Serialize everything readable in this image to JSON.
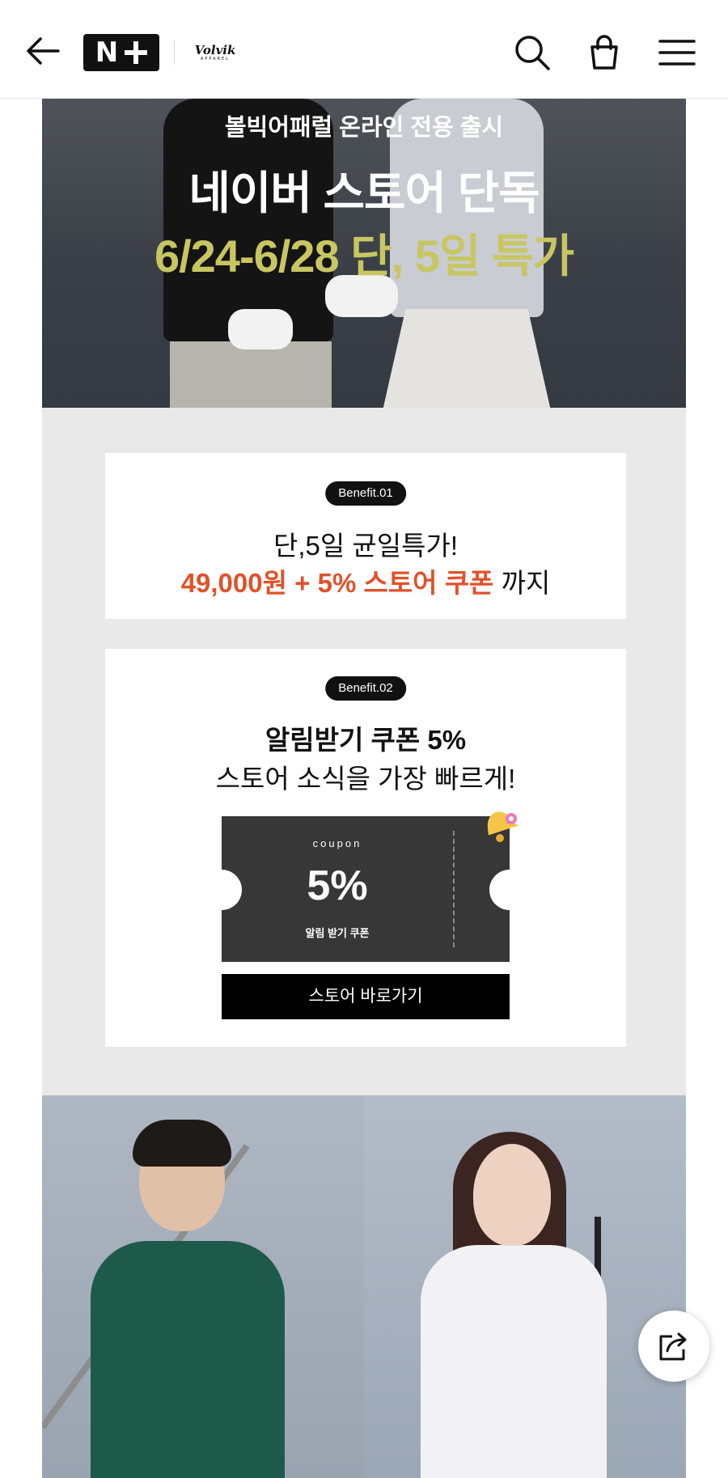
{
  "header": {
    "back_icon": "arrow-left-icon",
    "logo_n": "N",
    "brand_name": "Volvik",
    "brand_sub": "APPAREL",
    "search_icon": "search-icon",
    "cart_icon": "shopping-bag-icon",
    "menu_icon": "hamburger-menu-icon"
  },
  "hero": {
    "subtitle": "볼빅어패럴 온라인 전용 출시",
    "title": "네이버 스토어 단독",
    "promo": "6/24-6/28 단, 5일 특가"
  },
  "benefit1": {
    "badge": "Benefit.01",
    "line1": "단,5일 균일특가!",
    "line2_highlight": "49,000원 + 5% 스토어 쿠폰",
    "line2_rest": " 까지"
  },
  "benefit2": {
    "badge": "Benefit.02",
    "line1": "알림받기 쿠폰 5%",
    "line2": "스토어 소식을 가장 빠르게!",
    "coupon": {
      "label": "coupon",
      "value": "5%",
      "desc": "알림 받기 쿠폰"
    },
    "bell_icon": "bell-icon",
    "button": "스토어 바로가기"
  },
  "share": {
    "icon": "share-icon"
  },
  "colors": {
    "accent_orange": "#e0522b",
    "promo_yellow": "#c8c661",
    "coupon_dark": "#373737",
    "benefit_bg": "#e9e9e9"
  }
}
